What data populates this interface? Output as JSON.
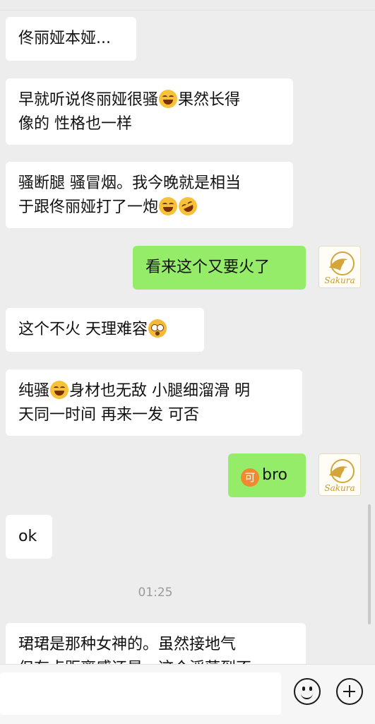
{
  "messages": [
    {
      "dir": "in",
      "text": "佟丽娅本娅..."
    },
    {
      "dir": "in",
      "text1": "早就听说佟丽娅很骚",
      "emoji1": "tears-of-joy-emoji",
      "text2": "果然长得",
      "line2": "像的 性格也一样"
    },
    {
      "dir": "in",
      "line1": "骚断腿 骚冒烟。我今晚就是相当",
      "line2a": "于跟佟丽娅打了一炮",
      "emoji1": "tears-of-joy-emoji",
      "emoji2": "rolling-laughing-emoji"
    },
    {
      "dir": "out",
      "text": "看来这个又要火了",
      "avatar_text": "Sakura"
    },
    {
      "dir": "in",
      "text": "这个不火 天理难容",
      "emoji1": "flushed-emoji"
    },
    {
      "dir": "in",
      "text1": "纯骚",
      "emoji1": "tears-of-joy-emoji",
      "text2": "身材也无敌 小腿细溜滑 明",
      "line2": "天同一时间 再来一发 可否"
    },
    {
      "dir": "out",
      "icon_char": "可",
      "text": "bro",
      "avatar_text": "Sakura"
    },
    {
      "dir": "in",
      "text": "ok"
    }
  ],
  "timestamp": "01:25",
  "last_message": {
    "line1": "珺珺是那种女神的。虽然接地气",
    "line2": "但有点距离感还是，这个淫荡到不"
  },
  "colors": {
    "incoming": "#ffffff",
    "outgoing": "#95ec69",
    "background": "#ededed"
  },
  "toolbar": {
    "emoji_icon": "smiley-icon",
    "add_icon": "plus-icon"
  }
}
